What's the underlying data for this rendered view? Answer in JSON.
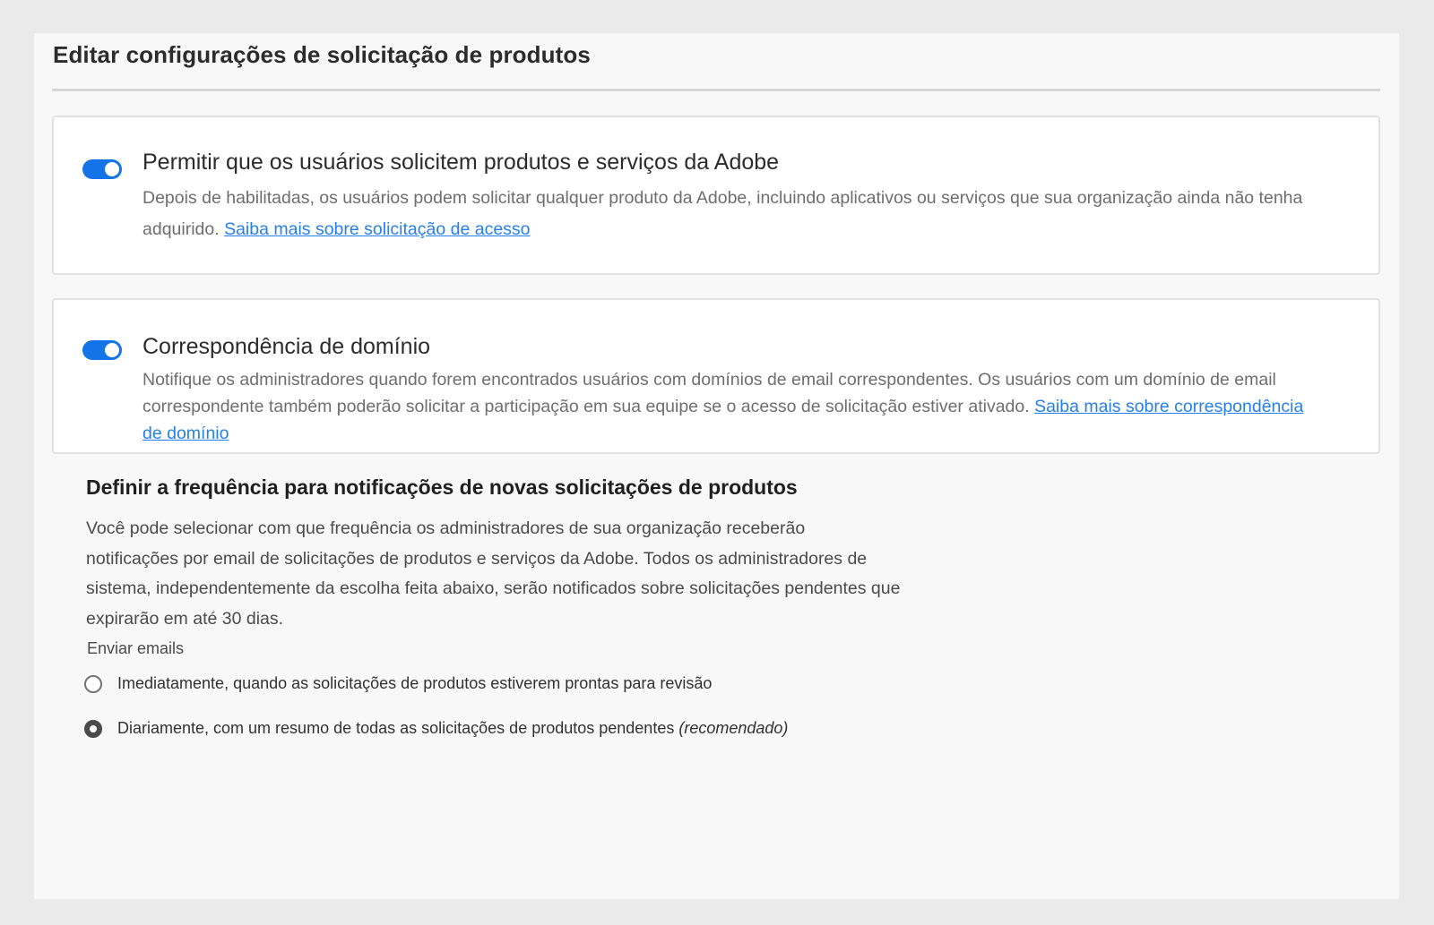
{
  "page": {
    "title": "Editar configurações de solicitação de produtos"
  },
  "request_access": {
    "enabled": true,
    "title": "Permitir que os usuários solicitem produtos e serviços da Adobe",
    "description": "Depois de habilitadas, os usuários podem solicitar qualquer produto da Adobe, incluindo aplicativos ou serviços que sua organização ainda não tenha adquirido.",
    "link": "Saiba mais sobre solicitação de acesso"
  },
  "domain_matching": {
    "enabled": true,
    "title": "Correspondência de domínio",
    "description": "Notifique os administradores quando forem encontrados usuários com domínios de email correspondentes. Os usuários com um domínio de email correspondente também poderão solicitar a participação em sua equipe se o acesso de solicitação estiver ativado.",
    "link": "Saiba mais sobre correspondência de domínio"
  },
  "frequency": {
    "title": "Definir a frequência para notificações de novas solicitações de produtos",
    "description": "Você pode selecionar com que frequência os administradores de sua organização receberão notificações por email de solicitações de produtos e serviços da Adobe. Todos os administradores de sistema, independentemente da escolha feita abaixo, serão notificados sobre solicitações pendentes que expirarão em até 30 dias.",
    "send_label": "Enviar emails",
    "options": [
      {
        "label": "Imediatamente, quando as solicitações de produtos estiverem prontas para revisão",
        "suffix": "",
        "selected": false
      },
      {
        "label": "Diariamente, com um resumo de todas as solicitações de produtos pendentes",
        "suffix": "(recomendado)",
        "selected": true
      }
    ]
  },
  "colors": {
    "accent": "#1473e6",
    "link": "#2680eb",
    "background": "#f8f8f8"
  }
}
